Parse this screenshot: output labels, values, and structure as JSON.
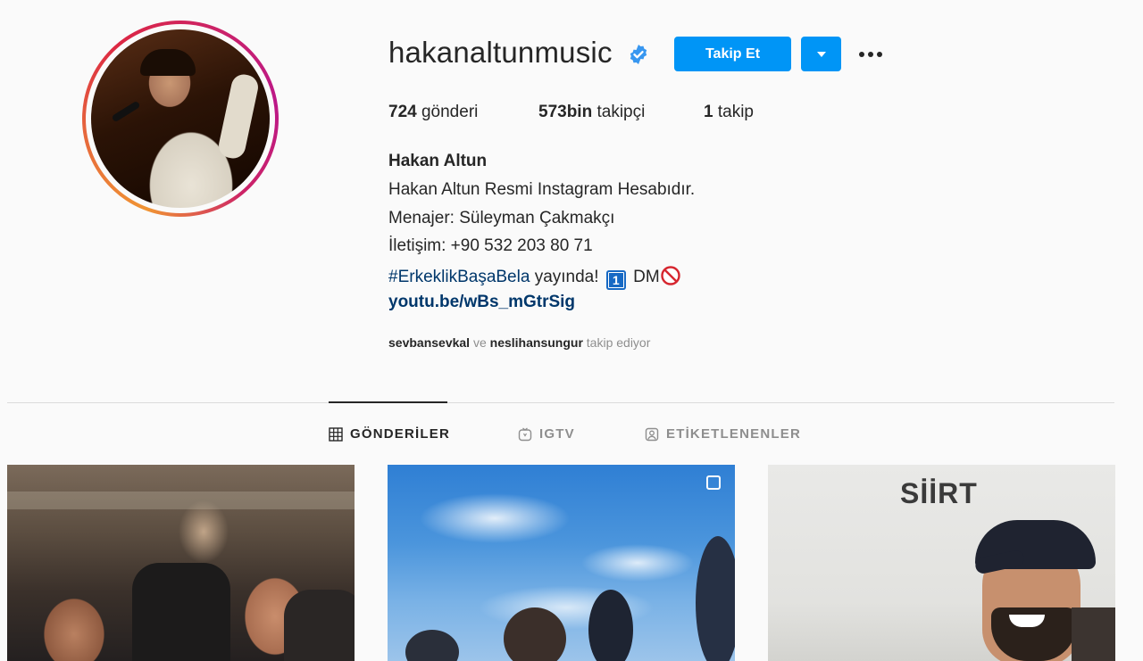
{
  "profile": {
    "username": "hakanaltunmusic",
    "verified": true,
    "follow_label": "Takip Et",
    "stats": {
      "posts_count": "724",
      "posts_label": "gönderi",
      "followers_count": "573bin",
      "followers_label": "takipçi",
      "following_count": "1",
      "following_label": "takip"
    },
    "full_name": "Hakan Altun",
    "bio": {
      "line1": "Hakan Altun Resmi Instagram Hesabıdır.",
      "line2": "Menajer: Süleyman Çakmakçı",
      "line3": "İletişim: +90 532 203 80 71",
      "hashtag": "#ErkeklikBaşaBela",
      "line4_rest": " yayında!",
      "badge": "1",
      "dm": "DM"
    },
    "link": "youtu.be/wBs_mGtrSig",
    "followed_by": {
      "user1": "sevbansevkal",
      "conj": " ve ",
      "user2": "neslihansungur",
      "suffix": " takip ediyor"
    }
  },
  "tabs": [
    {
      "label": "GÖNDERİLER",
      "icon": "grid-icon",
      "active": true
    },
    {
      "label": "IGTV",
      "icon": "igtv-icon",
      "active": false
    },
    {
      "label": "ETİKETLENENLER",
      "icon": "tagged-icon",
      "active": false
    }
  ],
  "posts": [
    {
      "icon": "none"
    },
    {
      "icon": "multi-photo-icon"
    },
    {
      "overlay_text": "SİİRT"
    }
  ],
  "colors": {
    "accent": "#0095f6",
    "link": "#00376b",
    "text": "#262626",
    "muted": "#8e8e8e",
    "background": "#fafafa"
  }
}
